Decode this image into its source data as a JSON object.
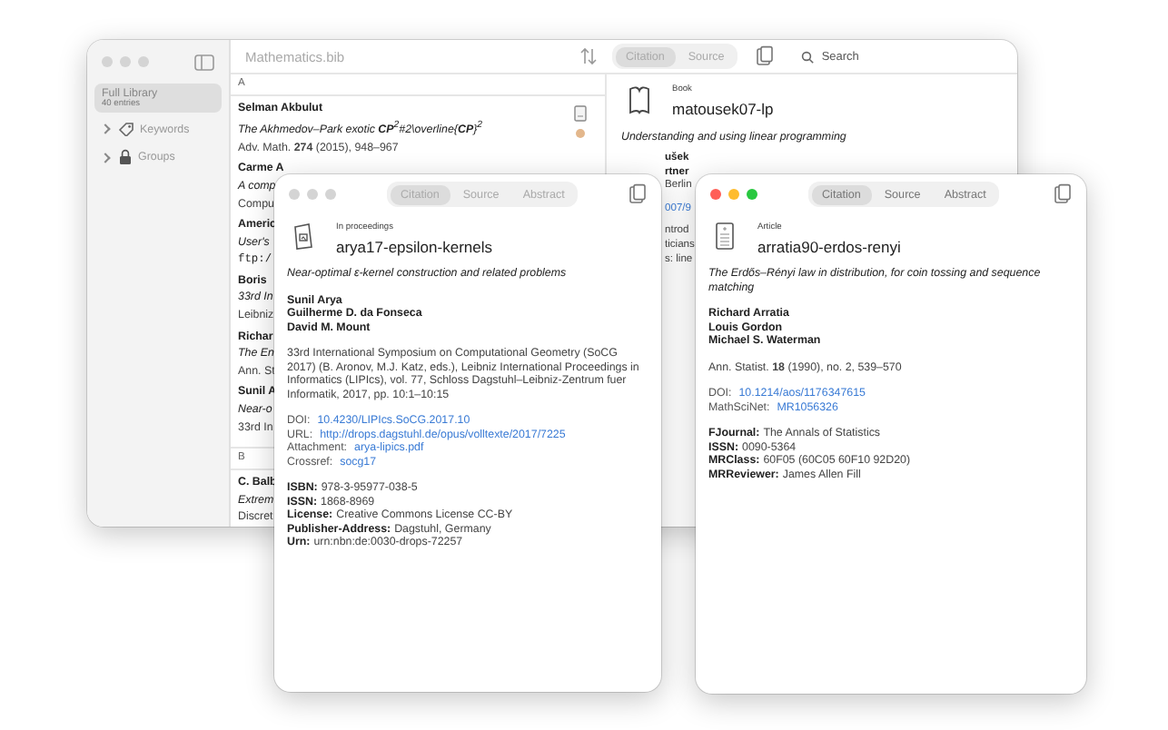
{
  "library_window": {
    "title": "Mathematics.bib",
    "active": false,
    "sidebar": {
      "items": [
        {
          "kind": "library",
          "label": "Full Library",
          "count": "40 entries",
          "selected": true
        },
        {
          "kind": "keywords",
          "label": "Keywords",
          "expanded": false,
          "selected": false
        },
        {
          "kind": "groups",
          "label": "Groups",
          "expanded": false,
          "selected": false
        }
      ]
    },
    "view_tabs": [
      {
        "label": "Citation",
        "selected": true
      },
      {
        "label": "Source",
        "selected": false
      }
    ],
    "search": {
      "placeholder": "Search"
    },
    "list": {
      "sections": [
        {
          "letter": "A",
          "entries": [
            {
              "has_file": true,
              "tagged": true,
              "lines": [
                {
                  "kind": "author",
                  "text": "Selman Akbulut"
                },
                {
                  "kind": "title",
                  "text": "The Akhmedov–Park exotic **CP**$^{2}$#2\\overline{**CP**}$^{2}$"
                },
                {
                  "kind": "venue",
                  "text": "Adv. Math. **274** (2015), 948–967"
                }
              ]
            },
            {
              "lines": [
                {
                  "kind": "author",
                  "text": "Carme A"
                },
                {
                  "kind": "title",
                  "text": "A comp"
                },
                {
                  "kind": "venue",
                  "text": "Compu"
                }
              ]
            },
            {
              "lines": [
                {
                  "kind": "author",
                  "text": "Americ"
                },
                {
                  "kind": "title",
                  "text": "User's"
                },
                {
                  "kind": "mono",
                  "text": "ftp:/"
                }
              ]
            },
            {
              "lines": [
                {
                  "kind": "author",
                  "text": "Boris"
                },
                {
                  "kind": "title",
                  "text": "33rd In"
                },
                {
                  "kind": "venue",
                  "text": "Leibniz"
                }
              ]
            },
            {
              "lines": [
                {
                  "kind": "author",
                  "text": "Richar"
                },
                {
                  "kind": "title",
                  "text": "The En"
                },
                {
                  "kind": "venue",
                  "text": "Ann. St"
                }
              ]
            },
            {
              "lines": [
                {
                  "kind": "author",
                  "text": "Sunil A"
                },
                {
                  "kind": "title",
                  "text": "Near-o"
                },
                {
                  "kind": "venue",
                  "text": "33rd In"
                }
              ]
            }
          ]
        },
        {
          "letter": "B",
          "entries": [
            {
              "lines": [
                {
                  "kind": "author",
                  "text": "C. Balb"
                },
                {
                  "kind": "title",
                  "text": "Extrem"
                },
                {
                  "kind": "venue",
                  "text": "Discret"
                }
              ]
            }
          ]
        }
      ]
    },
    "detail": {
      "kind": "book",
      "type": "Book",
      "key": "matousek07-lp",
      "title": "Understanding and using linear programming",
      "fragments": [
        {
          "kind": "author",
          "text": "ušek"
        },
        {
          "kind": "author",
          "text": "rtner"
        },
        {
          "kind": "venue",
          "text": "Berlin"
        },
        {
          "kind": "link",
          "text": "007/9"
        },
        {
          "kind": "venue",
          "text": "ntrod"
        },
        {
          "kind": "venue",
          "text": "ticians"
        },
        {
          "kind": "venue",
          "text": "s: line"
        }
      ]
    }
  },
  "preview_windows": [
    {
      "active": false,
      "kind": "proceedings",
      "tabs": [
        {
          "label": "Citation",
          "selected": true
        },
        {
          "label": "Source",
          "selected": false
        },
        {
          "label": "Abstract",
          "selected": false
        }
      ],
      "type": "In proceedings",
      "key": "arya17-epsilon-kernels",
      "title": "Near-optimal ε-kernel construction and related problems",
      "authors": [
        "Sunil Arya",
        "Guilherme D. da Fonseca",
        "David M. Mount"
      ],
      "venue": "33rd International Symposium on Computational Geometry (SoCG 2017) (B. Aronov, M.J. Katz, eds.), Leibniz International Proceedings in Informatics (LIPIcs), vol. 77, Schloss Dagstuhl–Leibniz-Zentrum fuer Informatik, 2017, pp. 10:1–10:15",
      "links": [
        {
          "label": "DOI:",
          "value": "10.4230/LIPIcs.SoCG.2017.10"
        },
        {
          "label": "URL:",
          "value": "http://drops.dagstuhl.de/opus/volltexte/2017/7225"
        },
        {
          "label": "Attachment:",
          "value": "arya-lipics.pdf"
        },
        {
          "label": "Crossref:",
          "value": "socg17"
        }
      ],
      "fields": [
        {
          "label": "ISBN:",
          "value": "978-3-95977-038-5"
        },
        {
          "label": "ISSN:",
          "value": "1868-8969"
        },
        {
          "label": "License:",
          "value": "Creative Commons License CC-BY"
        },
        {
          "label": "Publisher-Address:",
          "value": "Dagstuhl, Germany"
        },
        {
          "label": "Urn:",
          "value": "urn:nbn:de:0030-drops-72257"
        }
      ]
    },
    {
      "active": true,
      "kind": "article",
      "tabs": [
        {
          "label": "Citation",
          "selected": true
        },
        {
          "label": "Source",
          "selected": false
        },
        {
          "label": "Abstract",
          "selected": false
        }
      ],
      "type": "Article",
      "key": "arratia90-erdos-renyi",
      "title": "The Erdős–Rényi law in distribution, for coin tossing and sequence matching",
      "authors": [
        "Richard Arratia",
        "Louis Gordon",
        "Michael S. Waterman"
      ],
      "venue": "Ann. Statist. **18** (1990), no. 2, 539–570",
      "links": [
        {
          "label": "DOI:",
          "value": "10.1214/aos/1176347615"
        },
        {
          "label": "MathSciNet:",
          "value": "MR1056326"
        }
      ],
      "fields": [
        {
          "label": "FJournal:",
          "value": "The Annals of Statistics"
        },
        {
          "label": "ISSN:",
          "value": "0090-5364"
        },
        {
          "label": "MRClass:",
          "value": "60F05 (60C05 60F10 92D20)"
        },
        {
          "label": "MRReviewer:",
          "value": "James Allen Fill"
        }
      ]
    }
  ]
}
